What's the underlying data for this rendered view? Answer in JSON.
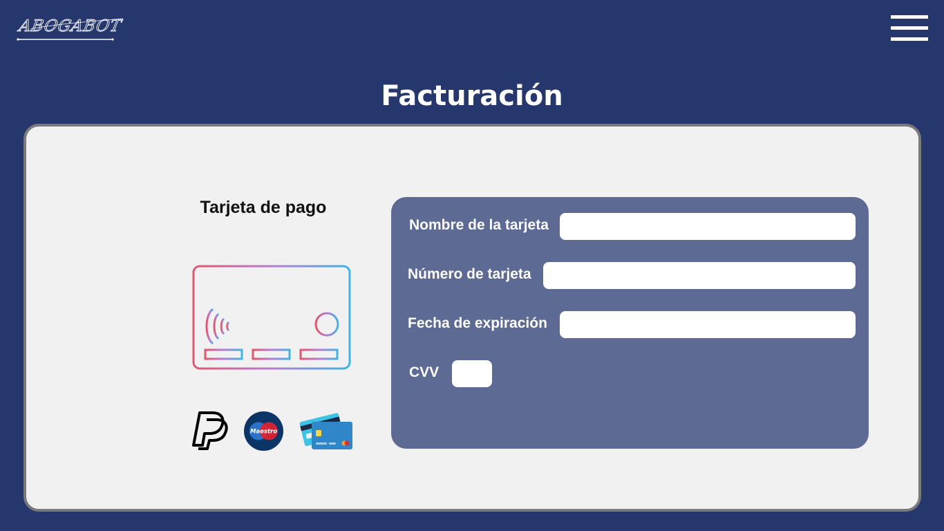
{
  "brand": {
    "logo_text": "ABOGABOT",
    "icon": "signature-logo"
  },
  "header": {
    "menu_icon": "hamburger-menu-icon"
  },
  "page": {
    "title": "Facturación"
  },
  "payment": {
    "section_title": "Tarjeta de pago",
    "illustration_icon": "contactless-card-icon",
    "methods": [
      {
        "icon": "paypal-icon"
      },
      {
        "icon": "maestro-icon",
        "label": "Maestro"
      },
      {
        "icon": "credit-cards-icon"
      }
    ]
  },
  "form": {
    "fields": [
      {
        "label": "Nombre de la tarjeta",
        "value": "",
        "placeholder": ""
      },
      {
        "label": "Número de tarjeta",
        "value": "",
        "placeholder": ""
      },
      {
        "label": "Fecha de expiración",
        "value": "",
        "placeholder": ""
      },
      {
        "label": "CVV",
        "value": "",
        "placeholder": ""
      }
    ]
  },
  "colors": {
    "background": "#26376d",
    "panel": "#f1f1f1",
    "form_box": "#5d6a94",
    "text_light": "#ffffff",
    "text_dark": "#111111"
  }
}
